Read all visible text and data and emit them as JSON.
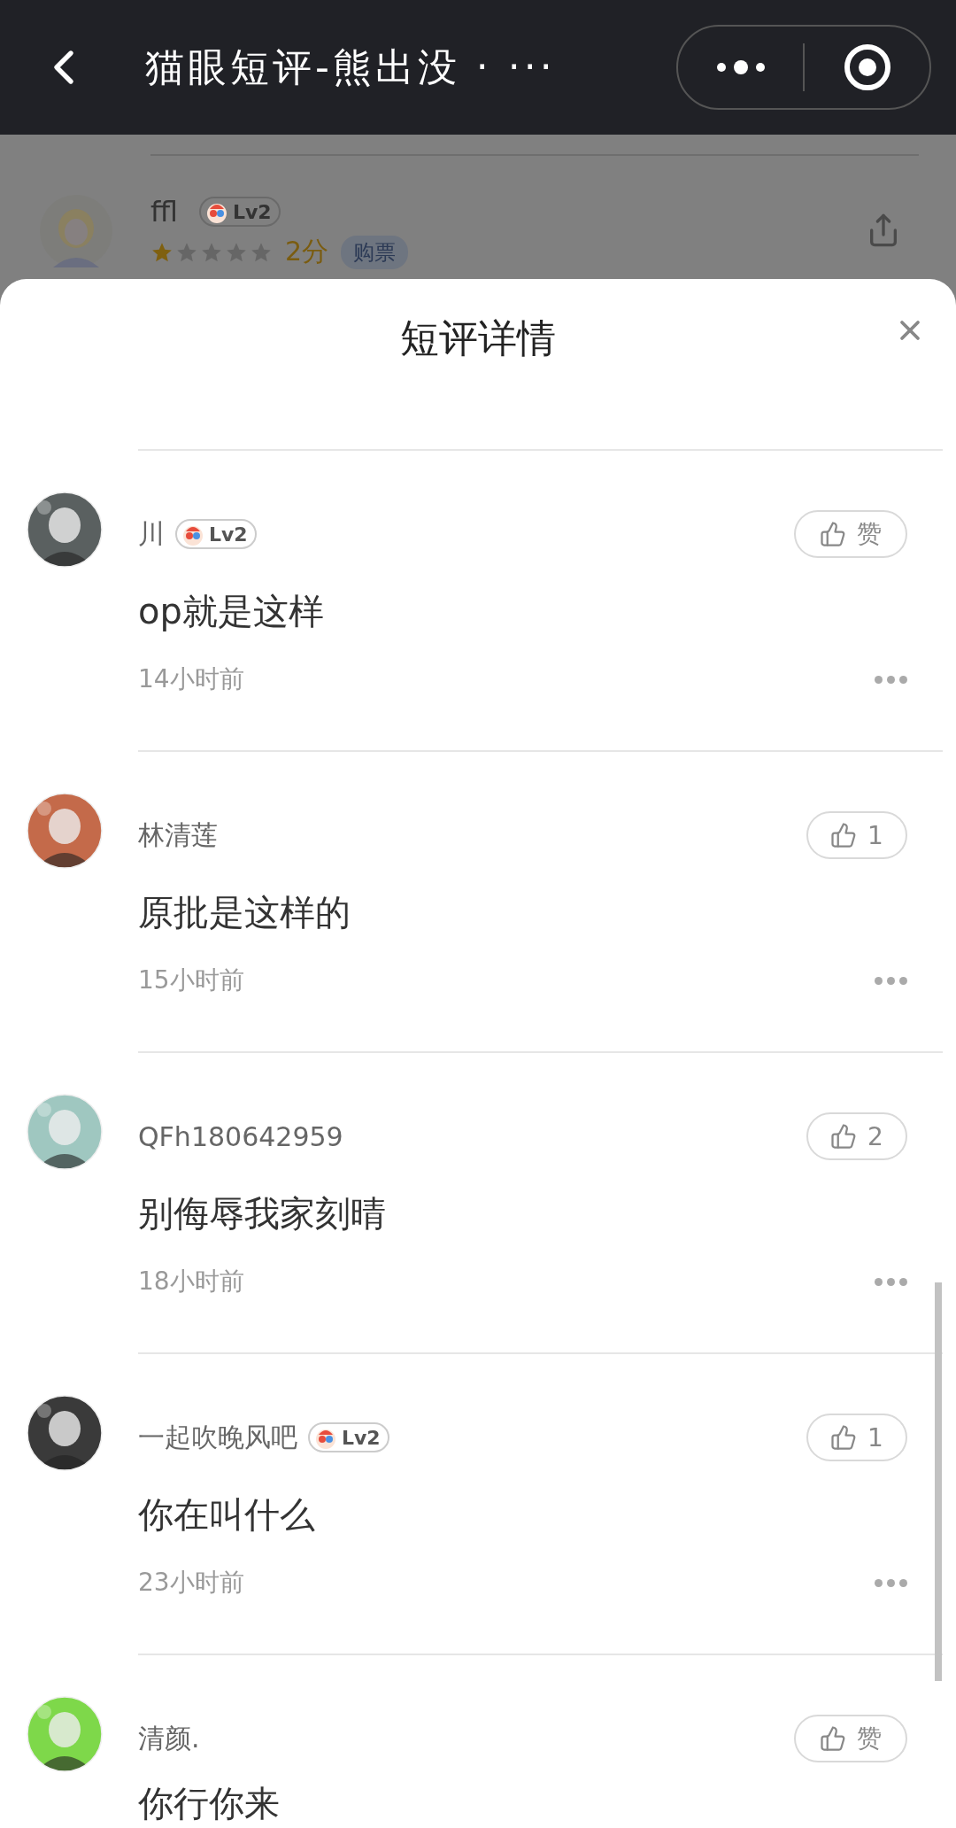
{
  "nav_bar": {
    "title": "猫眼短评-熊出没 · ···"
  },
  "background_review": {
    "user": "ffl",
    "level": "Lv2",
    "stars": 1,
    "score": "2分",
    "tag": "购票"
  },
  "sheet": {
    "title": "短评详情"
  },
  "comments": [
    {
      "user": "川",
      "level": "Lv2",
      "like": "赞",
      "text": "op就是这样",
      "time": "14小时前"
    },
    {
      "user": "林清莲",
      "like": "1",
      "text": "原批是这样的",
      "time": "15小时前"
    },
    {
      "user": "QFh180642959",
      "like": "2",
      "text": "别侮辱我家刻晴",
      "time": "18小时前"
    },
    {
      "user": "一起吹晚风吧",
      "level": "Lv2",
      "like": "1",
      "text": "你在叫什么",
      "time": "23小时前"
    },
    {
      "user": "清颜.",
      "like": "赞",
      "text": "你行你来"
    }
  ]
}
